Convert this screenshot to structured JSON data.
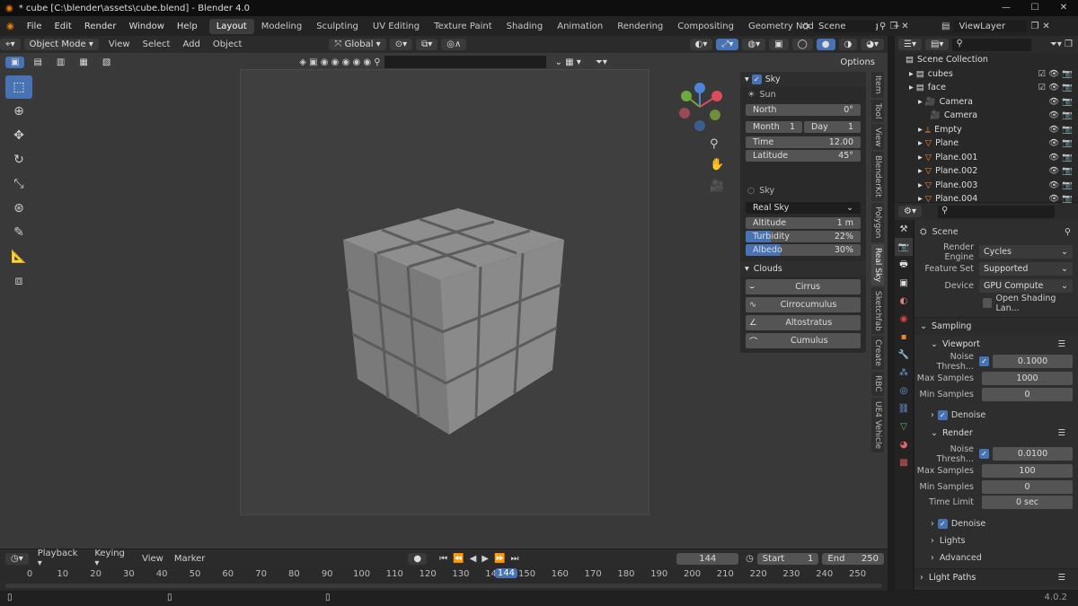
{
  "window": {
    "title": "* cube [C:\\blender\\assets\\cube.blend] - Blender 4.0"
  },
  "menu": [
    "File",
    "Edit",
    "Render",
    "Window",
    "Help"
  ],
  "workspaces": [
    "Layout",
    "Modeling",
    "Sculpting",
    "UV Editing",
    "Texture Paint",
    "Shading",
    "Animation",
    "Rendering",
    "Compositing",
    "Geometry Nodes",
    "Scripting"
  ],
  "active_workspace": "Layout",
  "scene": {
    "label": "Scene",
    "view_layer": "ViewLayer"
  },
  "viewport_header": {
    "mode": "Object Mode",
    "menus": [
      "View",
      "Select",
      "Add",
      "Object"
    ],
    "orientation": "Global",
    "options": "Options"
  },
  "npanel": {
    "sky_title": "Sky",
    "sun_label": "Sun",
    "north": {
      "label": "North",
      "value": "0°"
    },
    "month": {
      "label": "Month",
      "value": "1"
    },
    "day": {
      "label": "Day",
      "value": "1"
    },
    "time": {
      "label": "Time",
      "value": "12.00"
    },
    "latitude": {
      "label": "Latitude",
      "value": "45°"
    },
    "sky_label": "Sky",
    "sky_type": "Real Sky",
    "altitude": {
      "label": "Altitude",
      "value": "1 m"
    },
    "turbidity": {
      "label": "Turbidity",
      "value": "22%",
      "fill": 0.22
    },
    "albedo": {
      "label": "Albedo",
      "value": "30%",
      "fill": 0.3
    },
    "clouds_title": "Clouds",
    "clouds": [
      "Cirrus",
      "Cirrocumulus",
      "Altostratus",
      "Cumulus"
    ]
  },
  "vertical_tabs": [
    "Item",
    "Tool",
    "View",
    "BlenderKit",
    "Polygon",
    "Real Sky",
    "Sketchfab",
    "Create",
    "RBC",
    "UE4 Vehicle"
  ],
  "outliner": {
    "root": "Scene Collection",
    "rows": [
      {
        "name": "cubes",
        "indent": 1
      },
      {
        "name": "face",
        "indent": 1
      },
      {
        "name": "Camera",
        "indent": 2
      },
      {
        "name": "Camera",
        "indent": 3
      },
      {
        "name": "Empty",
        "indent": 2
      },
      {
        "name": "Plane",
        "indent": 2
      },
      {
        "name": "Plane.001",
        "indent": 2
      },
      {
        "name": "Plane.002",
        "indent": 2
      },
      {
        "name": "Plane.003",
        "indent": 2
      },
      {
        "name": "Plane.004",
        "indent": 2
      }
    ]
  },
  "properties": {
    "scene": "Scene",
    "render_engine": {
      "label": "Render Engine",
      "value": "Cycles"
    },
    "feature_set": {
      "label": "Feature Set",
      "value": "Supported"
    },
    "device": {
      "label": "Device",
      "value": "GPU Compute"
    },
    "osl": "Open Shading Lan...",
    "sampling": "Sampling",
    "viewport": "Viewport",
    "vp_noise": {
      "label": "Noise Thresh...",
      "value": "0.1000"
    },
    "vp_max": {
      "label": "Max Samples",
      "value": "1000"
    },
    "vp_min": {
      "label": "Min Samples",
      "value": "0"
    },
    "denoise": "Denoise",
    "render": "Render",
    "r_noise": {
      "label": "Noise Thresh...",
      "value": "0.0100"
    },
    "r_max": {
      "label": "Max Samples",
      "value": "100"
    },
    "r_min": {
      "label": "Min Samples",
      "value": "0"
    },
    "time_limit": {
      "label": "Time Limit",
      "value": "0 sec"
    },
    "denoise2": "Denoise",
    "lights": "Lights",
    "advanced": "Advanced",
    "light_paths": "Light Paths"
  },
  "timeline": {
    "menus": [
      "Playback",
      "Keying",
      "View",
      "Marker"
    ],
    "current_frame": "144",
    "start": {
      "label": "Start",
      "value": "1"
    },
    "end": {
      "label": "End",
      "value": "250"
    },
    "ticks": [
      "0",
      "10",
      "20",
      "30",
      "40",
      "50",
      "60",
      "70",
      "80",
      "90",
      "100",
      "110",
      "120",
      "130",
      "140",
      "150",
      "160",
      "170",
      "180",
      "190",
      "200",
      "210",
      "220",
      "230",
      "240",
      "250"
    ]
  },
  "status": {
    "version": "4.0.2"
  }
}
